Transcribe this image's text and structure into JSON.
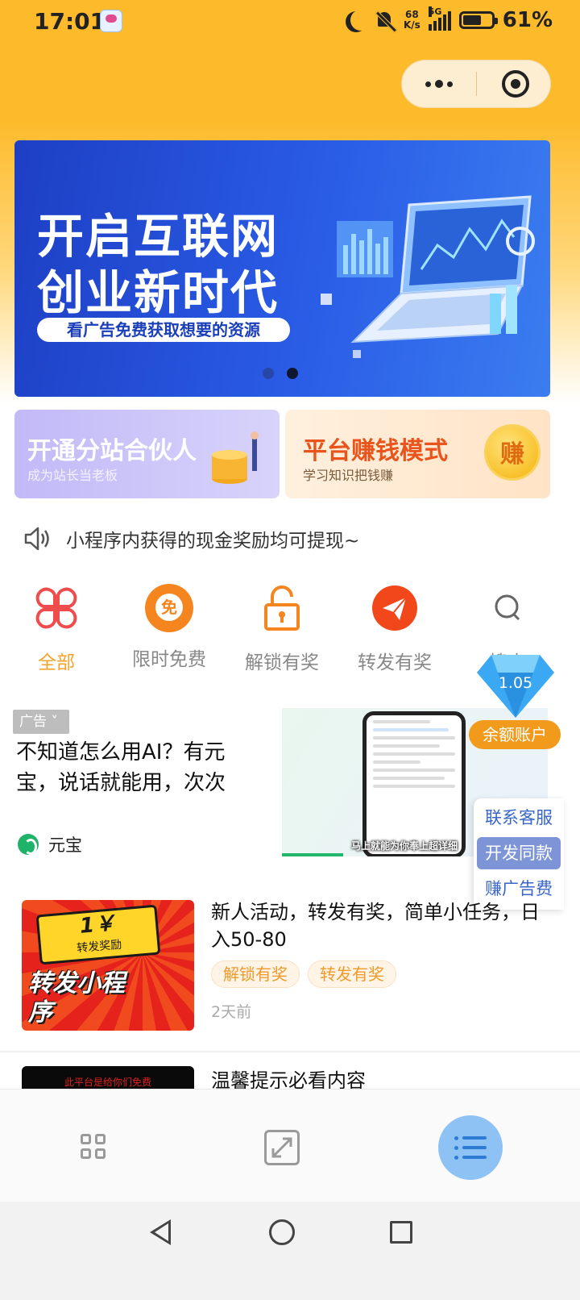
{
  "status_bar": {
    "time": "17:01",
    "net_speed_value": "68",
    "net_speed_unit": "K/s",
    "network": "5G",
    "battery": "61%"
  },
  "banner": {
    "line1": "开启互联网",
    "line2": "创业新时代",
    "subtitle": "看广告免费获取想要的资源",
    "slides": 2,
    "active_slide": 2
  },
  "promo": {
    "left_title": "开通分站合伙人",
    "left_subtitle": "成为站长当老板",
    "right_title": "平台赚钱模式",
    "right_subtitle": "学习知识把钱赚",
    "right_badge": "赚"
  },
  "notice": {
    "text": "小程序内获得的现金奖励均可提现~"
  },
  "categories": [
    {
      "label": "全部",
      "icon": "four-petal-icon",
      "active": true
    },
    {
      "label": "限时免费",
      "icon": "free-badge-icon",
      "badge": "免"
    },
    {
      "label": "解锁有奖",
      "icon": "unlock-icon"
    },
    {
      "label": "转发有奖",
      "icon": "share-plane-icon"
    },
    {
      "label": "搜索",
      "icon": "search-icon"
    }
  ],
  "ad": {
    "tag": "广告",
    "title": "不知道怎么用AI？有元宝，说话就能用，次次",
    "brand": "元宝",
    "caption": "马上就能为你奉上超详细"
  },
  "floating": {
    "balance_value": "1.05",
    "balance_button": "余额账户",
    "side_items": [
      "联系客服",
      "开发同款",
      "赚广告费"
    ]
  },
  "articles": [
    {
      "title": "新人活动，转发有奖，简单小任务，日入50-80",
      "tags": [
        "解锁有奖",
        "转发有奖"
      ],
      "time": "2天前",
      "thumb_price": "1￥",
      "thumb_label": "转发奖励",
      "thumb_text": "转发小程序"
    },
    {
      "title": "温馨提示必看内容",
      "thumb_text": "此平台是给你们免费"
    }
  ],
  "colors": {
    "header": "#fdbb2c",
    "accent": "#f5a32a",
    "tag_text": "#f09a2a",
    "link_blue": "#3a66c8"
  }
}
